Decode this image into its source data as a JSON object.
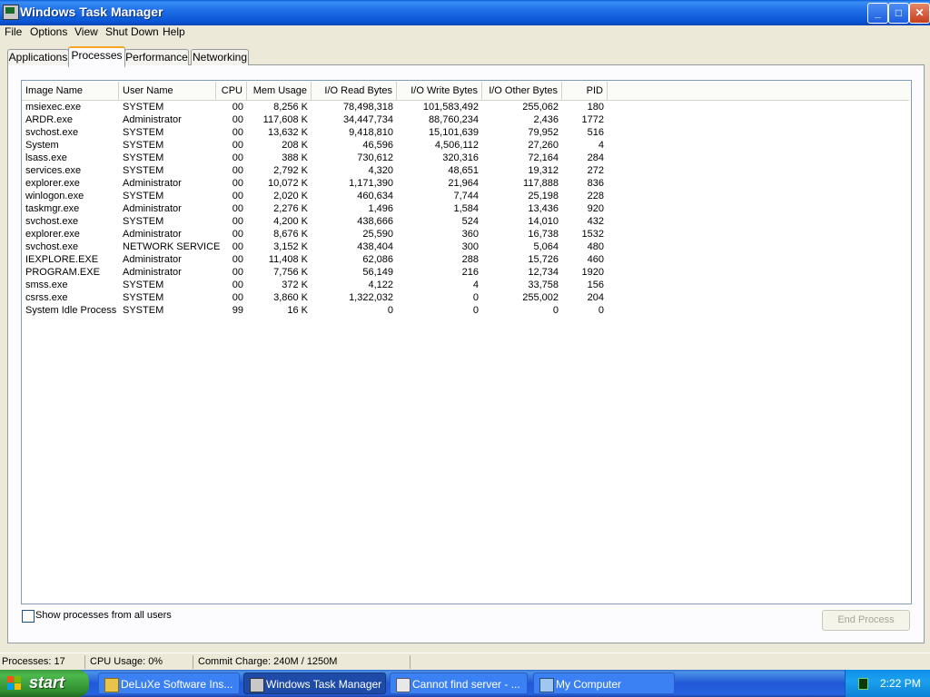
{
  "window": {
    "title": "Windows Task Manager",
    "buttons": {
      "minimize": "_",
      "maximize": "□",
      "close": "✕"
    }
  },
  "menu": [
    "File",
    "Options",
    "View",
    "Shut Down",
    "Help"
  ],
  "tabs": [
    "Applications",
    "Processes",
    "Performance",
    "Networking"
  ],
  "active_tab": "Processes",
  "columns": [
    "Image Name",
    "User Name",
    "CPU",
    "Mem Usage",
    "I/O Read Bytes",
    "I/O Write Bytes",
    "I/O Other Bytes",
    "PID"
  ],
  "processes": [
    [
      "msiexec.exe",
      "SYSTEM",
      "00",
      "8,256 K",
      "78,498,318",
      "101,583,492",
      "255,062",
      "180"
    ],
    [
      "ARDR.exe",
      "Administrator",
      "00",
      "117,608 K",
      "34,447,734",
      "88,760,234",
      "2,436",
      "1772"
    ],
    [
      "svchost.exe",
      "SYSTEM",
      "00",
      "13,632 K",
      "9,418,810",
      "15,101,639",
      "79,952",
      "516"
    ],
    [
      "System",
      "SYSTEM",
      "00",
      "208 K",
      "46,596",
      "4,506,112",
      "27,260",
      "4"
    ],
    [
      "lsass.exe",
      "SYSTEM",
      "00",
      "388 K",
      "730,612",
      "320,316",
      "72,164",
      "284"
    ],
    [
      "services.exe",
      "SYSTEM",
      "00",
      "2,792 K",
      "4,320",
      "48,651",
      "19,312",
      "272"
    ],
    [
      "explorer.exe",
      "Administrator",
      "00",
      "10,072 K",
      "1,171,390",
      "21,964",
      "117,888",
      "836"
    ],
    [
      "winlogon.exe",
      "SYSTEM",
      "00",
      "2,020 K",
      "460,634",
      "7,744",
      "25,198",
      "228"
    ],
    [
      "taskmgr.exe",
      "Administrator",
      "00",
      "2,276 K",
      "1,496",
      "1,584",
      "13,436",
      "920"
    ],
    [
      "svchost.exe",
      "SYSTEM",
      "00",
      "4,200 K",
      "438,666",
      "524",
      "14,010",
      "432"
    ],
    [
      "explorer.exe",
      "Administrator",
      "00",
      "8,676 K",
      "25,590",
      "360",
      "16,738",
      "1532"
    ],
    [
      "svchost.exe",
      "NETWORK SERVICE",
      "00",
      "3,152 K",
      "438,404",
      "300",
      "5,064",
      "480"
    ],
    [
      "IEXPLORE.EXE",
      "Administrator",
      "00",
      "11,408 K",
      "62,086",
      "288",
      "15,726",
      "460"
    ],
    [
      "PROGRAM.EXE",
      "Administrator",
      "00",
      "7,756 K",
      "56,149",
      "216",
      "12,734",
      "1920"
    ],
    [
      "smss.exe",
      "SYSTEM",
      "00",
      "372 K",
      "4,122",
      "4",
      "33,758",
      "156"
    ],
    [
      "csrss.exe",
      "SYSTEM",
      "00",
      "3,860 K",
      "1,322,032",
      "0",
      "255,002",
      "204"
    ],
    [
      "System Idle Process",
      "SYSTEM",
      "99",
      "16 K",
      "0",
      "0",
      "0",
      "0"
    ]
  ],
  "show_all_users": {
    "label": "Show processes from all users",
    "checked": false
  },
  "end_process_label": "End Process",
  "status": {
    "processes": "Processes: 17",
    "cpu": "CPU Usage: 0%",
    "commit": "Commit Charge: 240M / 1250M"
  },
  "taskbar": {
    "start_label": "start",
    "tasks": [
      {
        "label": "DeLuXe Software Ins...",
        "icon": "installer-icon",
        "active": false
      },
      {
        "label": "Windows Task Manager",
        "icon": "task-manager-icon",
        "active": true
      },
      {
        "label": "Cannot find server - ...",
        "icon": "internet-explorer-icon",
        "active": false
      },
      {
        "label": "My Computer",
        "icon": "my-computer-icon",
        "active": false
      }
    ],
    "clock": "2:22 PM"
  }
}
